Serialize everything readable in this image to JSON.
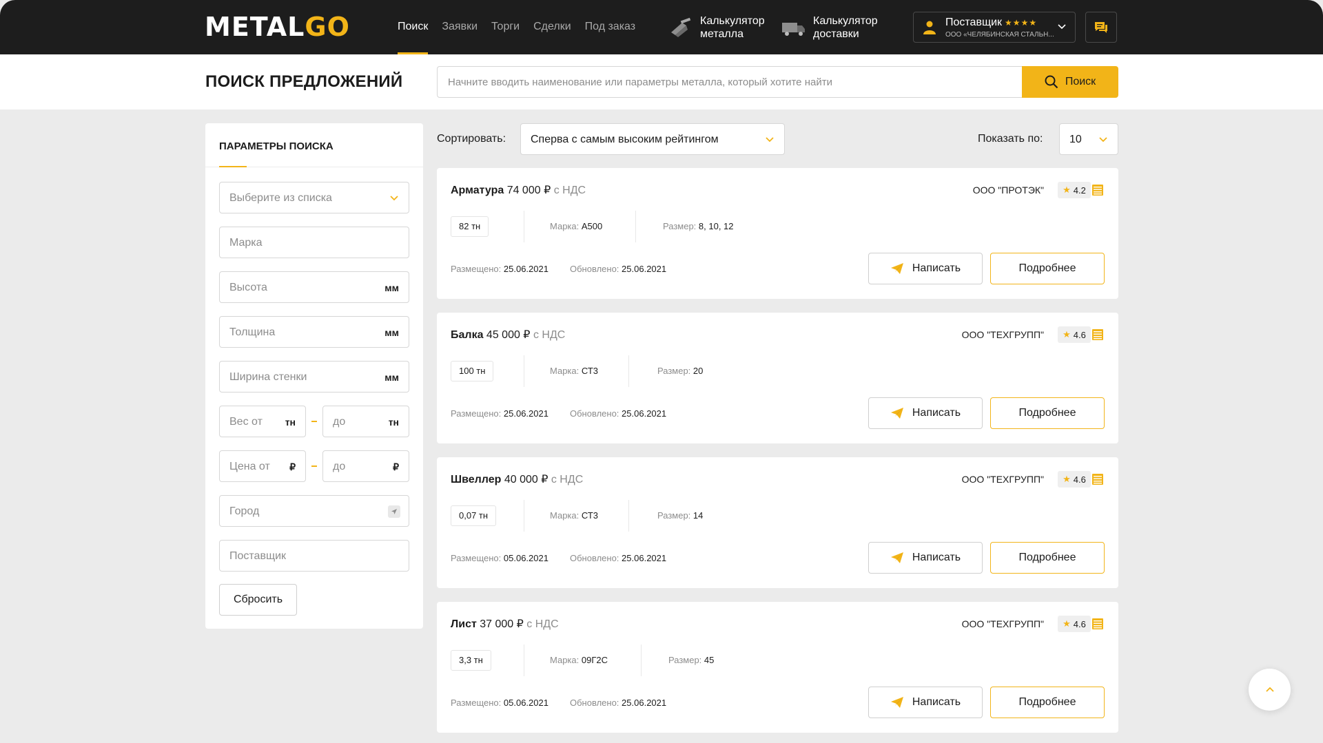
{
  "header": {
    "logo_part1": "METAL",
    "logo_part2": "GO",
    "nav": [
      "Поиск",
      "Заявки",
      "Торги",
      "Сделки",
      "Под заказ"
    ],
    "calc_metal": "Калькулятор металла",
    "calc_delivery": "Калькулятор доставки",
    "user_role": "Поставщик",
    "user_stars": "★★★★",
    "user_company": "ООО «ЧЕЛЯБИНСКАЯ СТАЛЬН..."
  },
  "search": {
    "page_title": "ПОИСК ПРЕДЛОЖЕНИЙ",
    "placeholder": "Начните вводить наименование или параметры металла, который хотите найти",
    "button_label": "Поиск"
  },
  "filters": {
    "title": "ПАРАМЕТРЫ ПОИСКА",
    "select_placeholder": "Выберите из списка",
    "grade": "Марка",
    "height": "Высота",
    "thickness": "Толщина",
    "wall_width": "Ширина стенки",
    "unit_mm": "мм",
    "weight_from": "Вес от",
    "weight_to": "до",
    "unit_t": "тн",
    "price_from": "Цена от",
    "price_to": "до",
    "unit_rub": "₽",
    "city": "Город",
    "supplier": "Поставщик",
    "reset_label": "Сбросить"
  },
  "sort": {
    "label": "Сортировать:",
    "value": "Сперва с самым высоким рейтингом",
    "show_label": "Показать по:",
    "show_value": "10"
  },
  "listing": {
    "grade_label": "Марка:",
    "size_label": "Размер:",
    "placed_label": "Размещено:",
    "updated_label": "Обновлено:",
    "write_label": "Написать",
    "more_label": "Подробнее",
    "cards": [
      {
        "name": "Арматура",
        "price": "74 000 ₽",
        "vat": "с НДС",
        "supplier": "ООО \"ПРОТЭК\"",
        "rating": "4.2",
        "qty": "82 тн",
        "grade": "А500",
        "size": "8, 10, 12",
        "placed": "25.06.2021",
        "updated": "25.06.2021"
      },
      {
        "name": "Балка",
        "price": "45 000 ₽",
        "vat": "с НДС",
        "supplier": "ООО \"ТЕХГРУПП\"",
        "rating": "4.6",
        "qty": "100 тн",
        "grade": "СТ3",
        "size": "20",
        "placed": "25.06.2021",
        "updated": "25.06.2021"
      },
      {
        "name": "Швеллер",
        "price": "40 000 ₽",
        "vat": "с НДС",
        "supplier": "ООО \"ТЕХГРУПП\"",
        "rating": "4.6",
        "qty": "0,07 тн",
        "grade": "СТ3",
        "size": "14",
        "placed": "05.06.2021",
        "updated": "25.06.2021"
      },
      {
        "name": "Лист",
        "price": "37 000 ₽",
        "vat": "с НДС",
        "supplier": "ООО \"ТЕХГРУПП\"",
        "rating": "4.6",
        "qty": "3,3 тн",
        "grade": "09Г2С",
        "size": "45",
        "placed": "05.06.2021",
        "updated": "25.06.2021"
      }
    ]
  },
  "colors": {
    "accent": "#f2b418",
    "header_bg": "#1d1d1d",
    "page_bg": "#ebebeb"
  },
  "icons": [
    "metal-calculator-icon",
    "truck-icon",
    "user-icon",
    "chevron-down-icon",
    "chat-icon",
    "search-icon",
    "location-icon",
    "star-icon",
    "document-icon",
    "paper-plane-icon",
    "chevron-up-icon"
  ]
}
